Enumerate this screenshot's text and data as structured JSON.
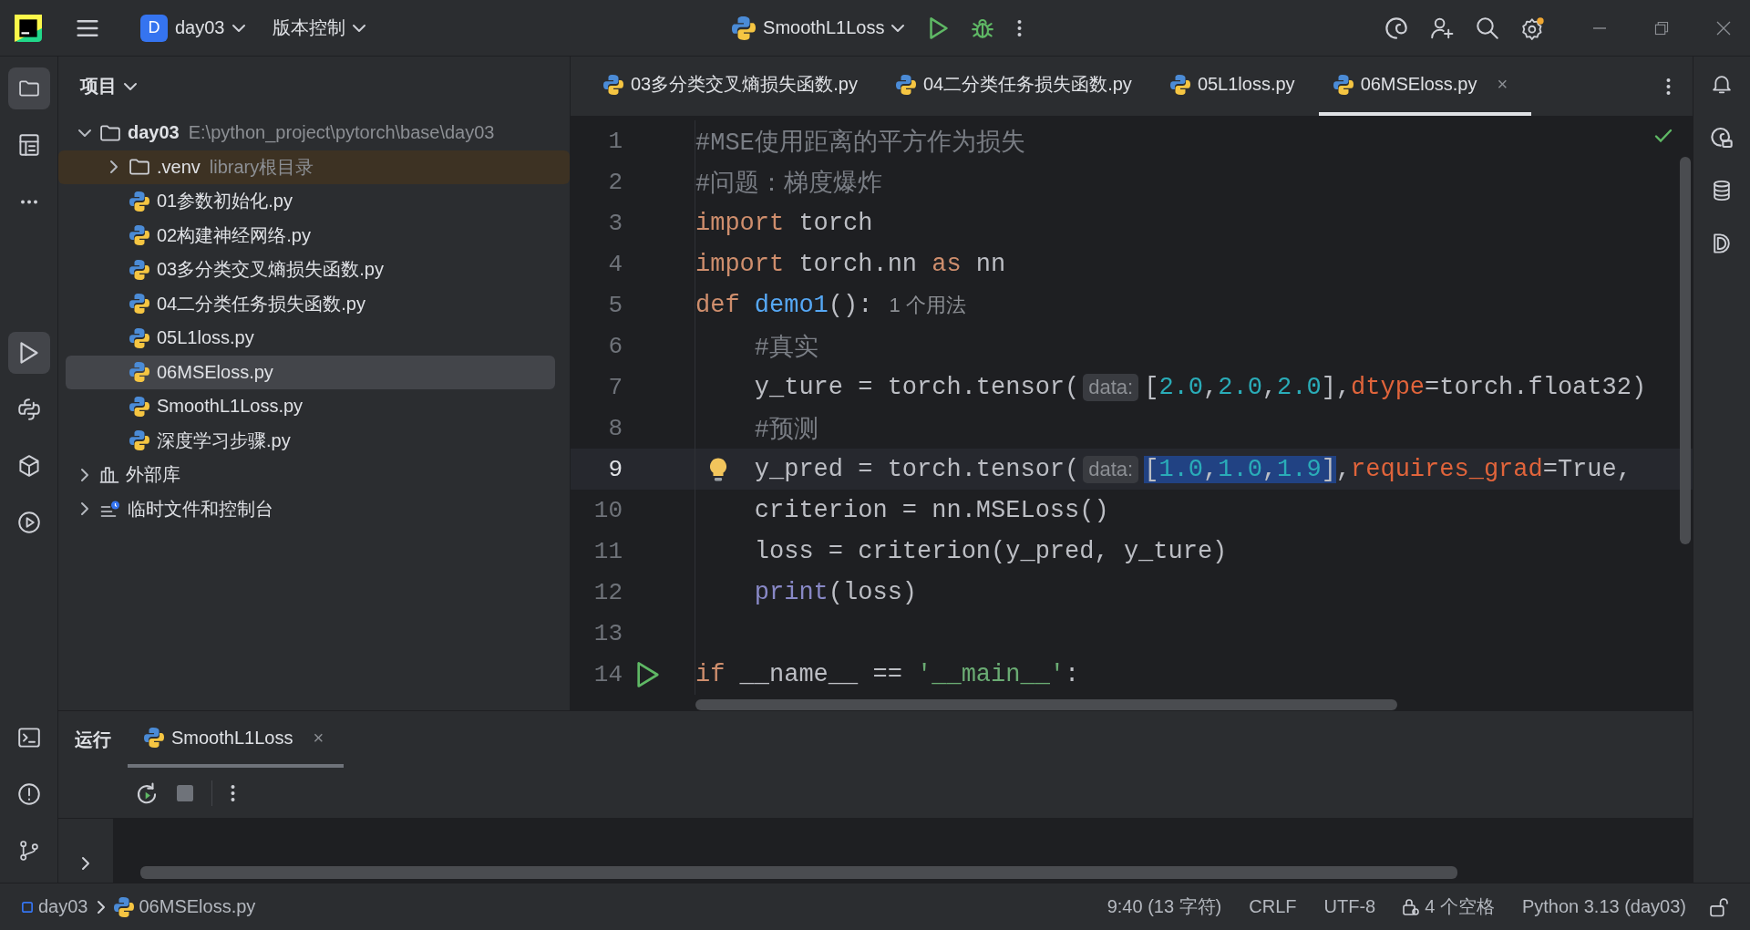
{
  "title_bar": {
    "project": {
      "badge": "D",
      "name": "day03"
    },
    "vcs": "版本控制",
    "run_config": "SmoothL1Loss"
  },
  "project_panel": {
    "title": "项目",
    "tree": [
      {
        "name": "day03",
        "path": "E:\\python_project\\pytorch\\base\\day03",
        "kind": "folder",
        "expanded": true,
        "selected": false,
        "children": [
          {
            "name": ".venv",
            "note": "library根目录",
            "kind": "excluded-folder",
            "expanded": false,
            "selected": false
          },
          {
            "name": "01参数初始化.py",
            "kind": "python",
            "selected": false
          },
          {
            "name": "02构建神经网络.py",
            "kind": "python",
            "selected": false
          },
          {
            "name": "03多分类交叉熵损失函数.py",
            "kind": "python",
            "selected": false
          },
          {
            "name": "04二分类任务损失函数.py",
            "kind": "python",
            "selected": false
          },
          {
            "name": "05L1loss.py",
            "kind": "python",
            "selected": false
          },
          {
            "name": "06MSEloss.py",
            "kind": "python",
            "selected": true
          },
          {
            "name": "SmoothL1Loss.py",
            "kind": "python",
            "selected": false
          },
          {
            "name": "深度学习步骤.py",
            "kind": "python",
            "selected": false
          }
        ]
      },
      {
        "name": "外部库",
        "kind": "library",
        "expanded": false,
        "selected": false
      },
      {
        "name": "临时文件和控制台",
        "kind": "scratches",
        "expanded": false,
        "selected": false
      }
    ]
  },
  "editor": {
    "tabs": [
      {
        "label": "03多分类交叉熵损失函数.py",
        "selected": false
      },
      {
        "label": "04二分类任务损失函数.py",
        "selected": false
      },
      {
        "label": "05L1loss.py",
        "selected": false
      },
      {
        "label": "06MSEloss.py",
        "selected": true,
        "close": "×"
      }
    ],
    "lines": [
      {
        "number": "1",
        "current": false,
        "tokens": [
          {
            "text": "#MSE使用距离的平方作为损失",
            "kind": "comment"
          }
        ]
      },
      {
        "number": "2",
        "current": false,
        "tokens": [
          {
            "text": "#问题：梯度爆炸",
            "kind": "comment"
          }
        ]
      },
      {
        "number": "3",
        "current": false,
        "tokens": [
          {
            "text": "import",
            "kind": "keyword"
          },
          {
            "text": " torch",
            "kind": "plain"
          }
        ]
      },
      {
        "number": "4",
        "current": false,
        "tokens": [
          {
            "text": "import",
            "kind": "keyword"
          },
          {
            "text": " torch.nn ",
            "kind": "plain"
          },
          {
            "text": "as",
            "kind": "keyword"
          },
          {
            "text": " nn",
            "kind": "plain"
          }
        ]
      },
      {
        "number": "5",
        "current": false,
        "tokens": [
          {
            "text": "def ",
            "kind": "keyword"
          },
          {
            "text": "demo1",
            "kind": "function"
          },
          {
            "text": "():",
            "kind": "plain"
          },
          {
            "text": "1 个用法",
            "kind": "usage"
          }
        ]
      },
      {
        "number": "6",
        "current": false,
        "tokens": [
          {
            "text": "    #真实",
            "kind": "comment"
          }
        ]
      },
      {
        "number": "7",
        "current": false,
        "tokens": [
          {
            "text": "    y_ture = torch.tensor(",
            "kind": "plain"
          },
          {
            "text": "data:",
            "kind": "hint"
          },
          {
            "text": "[",
            "kind": "plain"
          },
          {
            "text": "2.0",
            "kind": "number"
          },
          {
            "text": ",",
            "kind": "plain"
          },
          {
            "text": "2.0",
            "kind": "number"
          },
          {
            "text": ",",
            "kind": "plain"
          },
          {
            "text": "2.0",
            "kind": "number"
          },
          {
            "text": "],",
            "kind": "plain"
          },
          {
            "text": "dtype",
            "kind": "param"
          },
          {
            "text": "=torch.float32)",
            "kind": "plain"
          }
        ]
      },
      {
        "number": "8",
        "current": false,
        "tokens": [
          {
            "text": "    #预测",
            "kind": "comment"
          }
        ]
      },
      {
        "number": "9",
        "current": true,
        "gutter": {
          "kind": "bulb"
        },
        "tokens": [
          {
            "text": "    y_pred = torch.tensor(",
            "kind": "plain"
          },
          {
            "text": "data:",
            "kind": "hint"
          },
          {
            "kind": "selection",
            "tokens": [
              {
                "text": "[",
                "kind": "plain"
              },
              {
                "text": "1.0",
                "kind": "number"
              },
              {
                "text": ",",
                "kind": "plain"
              },
              {
                "text": "1.0",
                "kind": "number"
              },
              {
                "text": ",",
                "kind": "plain"
              },
              {
                "text": "1.9",
                "kind": "number"
              },
              {
                "text": "]",
                "kind": "plain"
              }
            ]
          },
          {
            "text": ",",
            "kind": "plain"
          },
          {
            "text": "requires_grad",
            "kind": "param"
          },
          {
            "text": "=True,",
            "kind": "plain"
          }
        ]
      },
      {
        "number": "10",
        "current": false,
        "tokens": [
          {
            "text": "    criterion = nn.MSELoss()",
            "kind": "plain"
          }
        ]
      },
      {
        "number": "11",
        "current": false,
        "tokens": [
          {
            "text": "    loss = criterion(y_pred, y_ture)",
            "kind": "plain"
          }
        ]
      },
      {
        "number": "12",
        "current": false,
        "tokens": [
          {
            "text": "    print",
            "kind": "builtin"
          },
          {
            "text": "(loss)",
            "kind": "plain"
          }
        ]
      },
      {
        "number": "13",
        "current": false
      },
      {
        "number": "14",
        "current": false,
        "gutter": {
          "kind": "run"
        },
        "tokens": [
          {
            "text": "if",
            "kind": "keyword"
          },
          {
            "text": " __name__ == ",
            "kind": "plain"
          },
          {
            "text": "'__main__'",
            "kind": "string"
          },
          {
            "text": ":",
            "kind": "plain"
          }
        ]
      }
    ]
  },
  "run_panel": {
    "title": "运行",
    "tabs": [
      {
        "label": "SmoothL1Loss",
        "selected": true,
        "close": "×"
      }
    ]
  },
  "status_bar": {
    "breadcrumb": [
      "day03",
      "06MSEloss.py"
    ],
    "position": "9:40 (13 字符)",
    "line_separator": "CRLF",
    "encoding": "UTF-8",
    "indent": "4 个空格",
    "interpreter": "Python 3.13 (day03)"
  }
}
